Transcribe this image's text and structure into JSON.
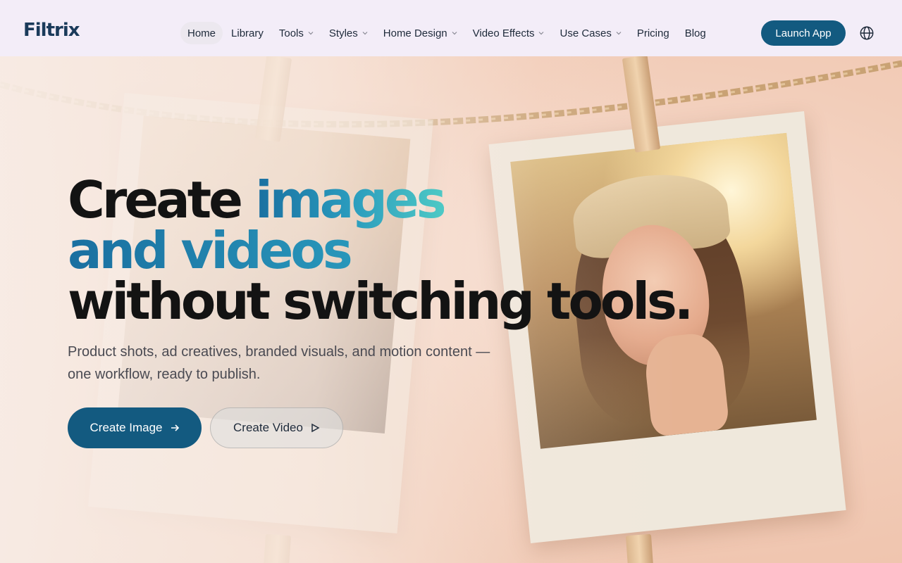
{
  "brand": {
    "logo": "Filtrix",
    "accent": "#135a80"
  },
  "nav": {
    "items": [
      {
        "label": "Home",
        "active": true,
        "dropdown": false
      },
      {
        "label": "Library",
        "active": false,
        "dropdown": false
      },
      {
        "label": "Tools",
        "active": false,
        "dropdown": true
      },
      {
        "label": "Styles",
        "active": false,
        "dropdown": true
      },
      {
        "label": "Home Design",
        "active": false,
        "dropdown": true
      },
      {
        "label": "Video Effects",
        "active": false,
        "dropdown": true
      },
      {
        "label": "Use Cases",
        "active": false,
        "dropdown": true
      },
      {
        "label": "Pricing",
        "active": false,
        "dropdown": false
      },
      {
        "label": "Blog",
        "active": false,
        "dropdown": false
      }
    ],
    "launch_label": "Launch App",
    "language_icon": "globe-icon"
  },
  "hero": {
    "headline_line1_a": "Create ",
    "headline_line1_b": "images",
    "headline_line2": "and videos",
    "headline_line3": "without switching tools.",
    "subtext": "Product shots, ad creatives, branded visuals, and motion content — one workflow, ready to publish.",
    "primary_cta": "Create Image",
    "primary_icon": "arrow-right-icon",
    "secondary_cta": "Create Video",
    "secondary_icon": "play-icon"
  }
}
